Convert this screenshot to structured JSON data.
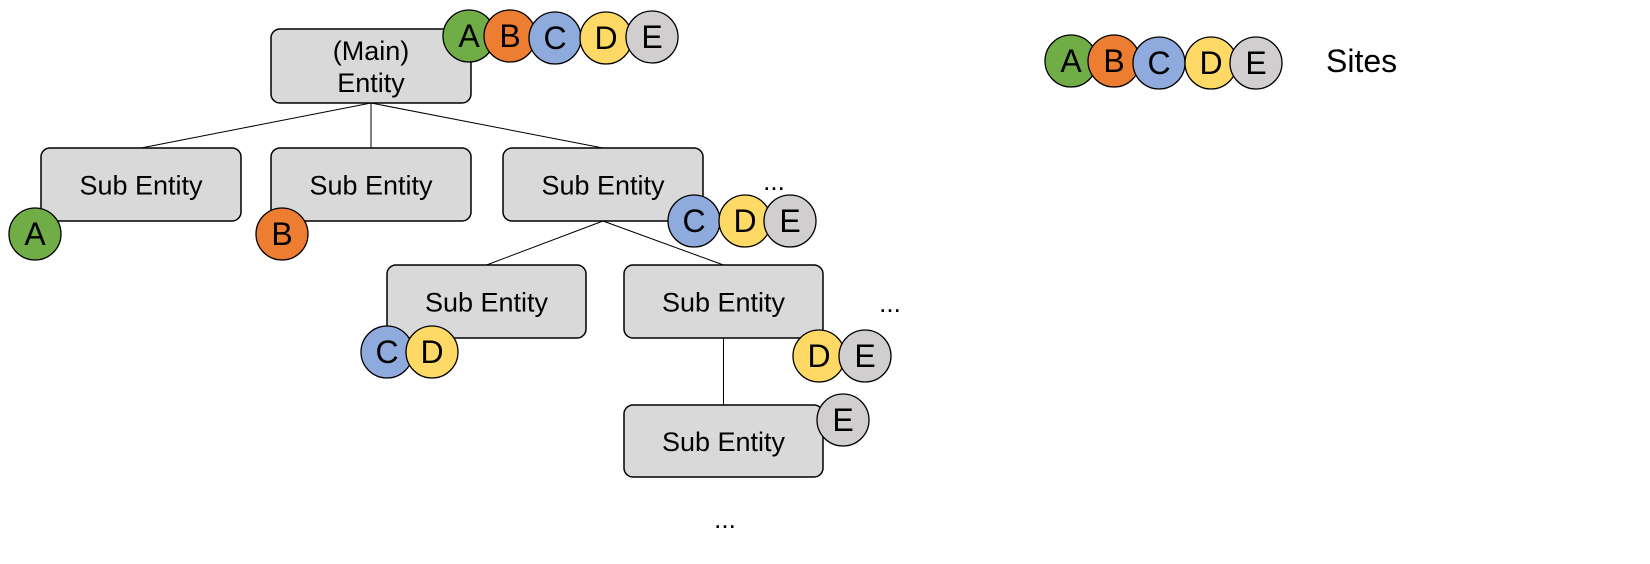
{
  "sites": {
    "A": {
      "label": "A",
      "color": "#70ad47"
    },
    "B": {
      "label": "B",
      "color": "#ed7d31"
    },
    "C": {
      "label": "C",
      "color": "#8faadc"
    },
    "D": {
      "label": "D",
      "color": "#ffd966"
    },
    "E": {
      "label": "E",
      "color": "#d0cece"
    }
  },
  "legend": {
    "label": "Sites",
    "sites": [
      "A",
      "B",
      "C",
      "D",
      "E"
    ]
  },
  "nodes": [
    {
      "id": "main",
      "label_lines": [
        "(Main)",
        "Entity"
      ],
      "sites": [
        "A",
        "B",
        "C",
        "D",
        "E"
      ],
      "children": [
        "s1",
        "s2",
        "s3"
      ]
    },
    {
      "id": "s1",
      "label_lines": [
        "Sub Entity"
      ],
      "sites": [
        "A"
      ],
      "children": []
    },
    {
      "id": "s2",
      "label_lines": [
        "Sub Entity"
      ],
      "sites": [
        "B"
      ],
      "children": []
    },
    {
      "id": "s3",
      "label_lines": [
        "Sub Entity"
      ],
      "sites": [
        "C",
        "D",
        "E"
      ],
      "children": [
        "s4",
        "s5"
      ],
      "ellipsis": "..."
    },
    {
      "id": "s4",
      "label_lines": [
        "Sub Entity"
      ],
      "sites": [
        "C",
        "D"
      ],
      "children": []
    },
    {
      "id": "s5",
      "label_lines": [
        "Sub Entity"
      ],
      "sites": [
        "D",
        "E"
      ],
      "children": [
        "s6"
      ],
      "ellipsis": "..."
    },
    {
      "id": "s6",
      "label_lines": [
        "Sub Entity"
      ],
      "sites": [
        "E"
      ],
      "children": [],
      "ellipsis": "..."
    }
  ],
  "box_fill": "#d9d9d9"
}
